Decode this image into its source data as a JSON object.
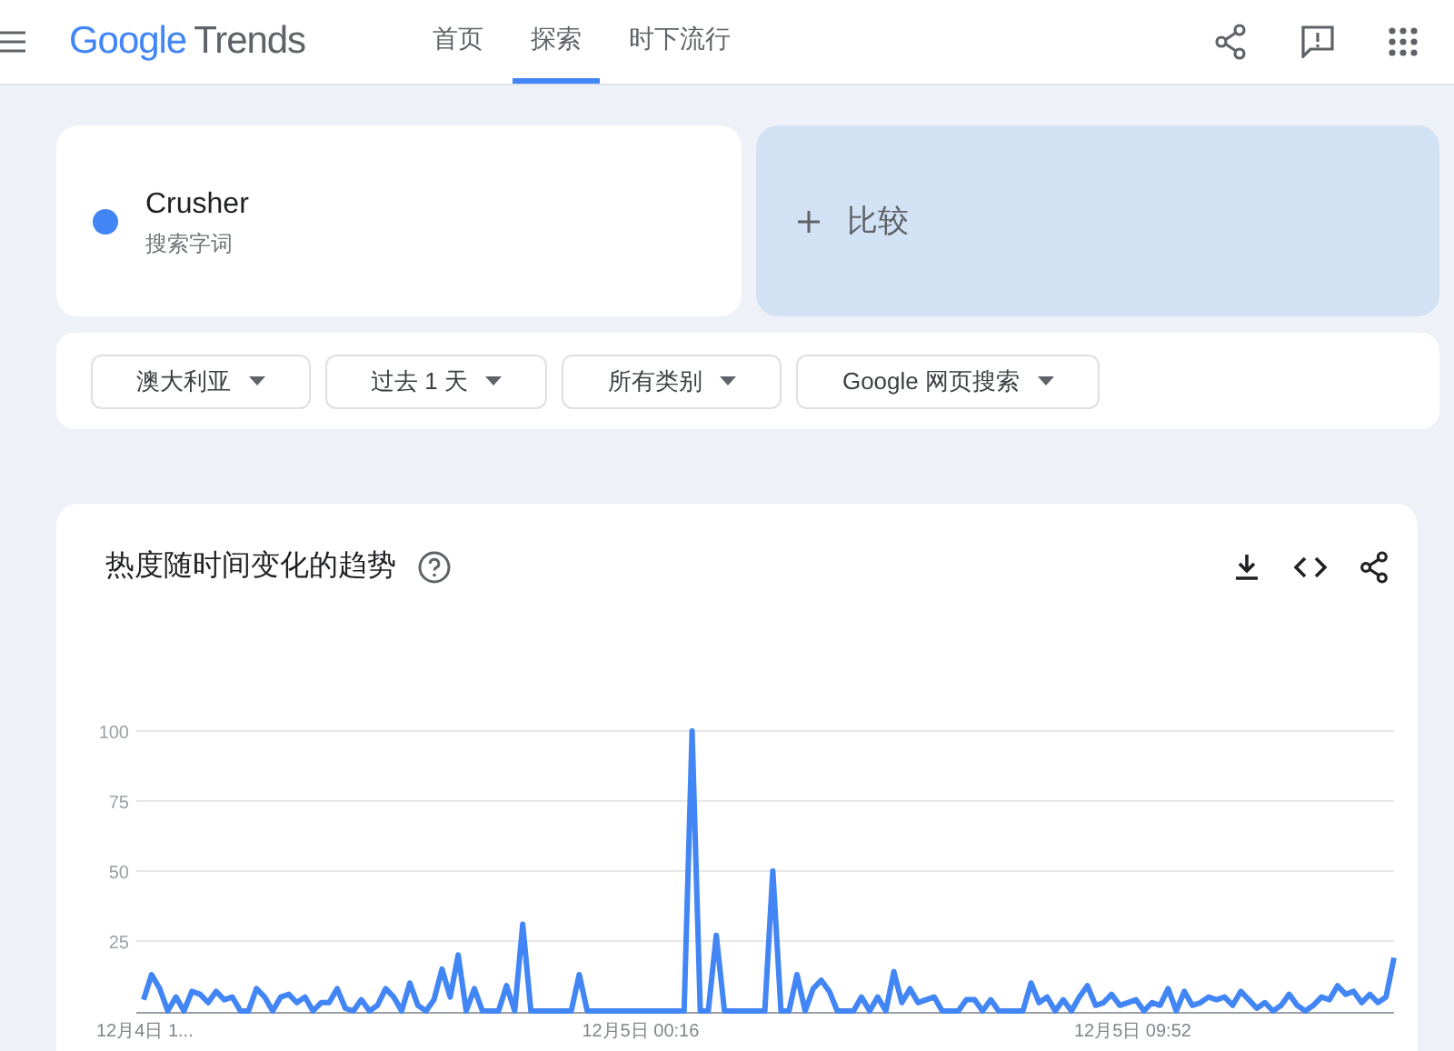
{
  "header": {
    "logo_google": "Google",
    "logo_product": "Trends",
    "nav": [
      {
        "label": "首页",
        "selected": false
      },
      {
        "label": "探索",
        "selected": true
      },
      {
        "label": "时下流行",
        "selected": false
      }
    ]
  },
  "search_terms": [
    {
      "term": "Crusher",
      "subtitle": "搜索字词",
      "color": "#4285f4"
    }
  ],
  "compare": {
    "label": "比较"
  },
  "filters": [
    {
      "label": "澳大利亚"
    },
    {
      "label": "过去 1 天"
    },
    {
      "label": "所有类别"
    },
    {
      "label": "Google 网页搜索"
    }
  ],
  "interest_over_time": {
    "title": "热度随时间变化的趋势",
    "chart_data": {
      "type": "line",
      "ylim": [
        0,
        100
      ],
      "yticks": [
        25,
        50,
        75,
        100
      ],
      "grid": true,
      "series": [
        {
          "color": "#4285f4",
          "values": [
            4,
            13,
            8,
            0,
            5,
            0,
            7,
            6,
            3,
            7,
            4,
            5,
            0,
            0,
            8,
            5,
            0,
            5,
            6,
            3,
            5,
            0,
            3,
            3,
            8,
            1,
            0,
            4,
            0,
            2,
            8,
            5,
            0,
            10,
            2,
            0,
            4,
            15,
            5,
            20,
            0,
            8,
            0,
            0,
            0,
            9,
            0,
            31,
            0,
            0,
            0,
            0,
            0,
            0,
            13,
            0,
            0,
            0,
            0,
            0,
            0,
            0,
            0,
            0,
            0,
            0,
            0,
            0,
            100,
            0,
            0,
            27,
            0,
            0,
            0,
            0,
            0,
            0,
            50,
            0,
            0,
            13,
            0,
            8,
            11,
            7,
            0,
            0,
            0,
            5,
            0,
            5,
            0,
            14,
            3,
            8,
            3,
            4,
            5,
            0,
            0,
            0,
            4,
            4,
            0,
            4,
            0,
            0,
            0,
            0,
            10,
            3,
            5,
            0,
            4,
            0,
            5,
            9,
            2,
            3,
            6,
            2,
            3,
            4,
            0,
            3,
            2,
            8,
            0,
            7,
            2,
            3,
            5,
            4,
            5,
            2,
            7,
            4,
            1,
            3,
            0,
            2,
            6,
            2,
            0,
            2,
            5,
            4,
            9,
            6,
            7,
            3,
            6,
            3,
            5,
            19
          ]
        }
      ]
    },
    "time_labels": [
      "12月4日 1...",
      "12月5日 00:16",
      "12月5日 09:52"
    ]
  }
}
